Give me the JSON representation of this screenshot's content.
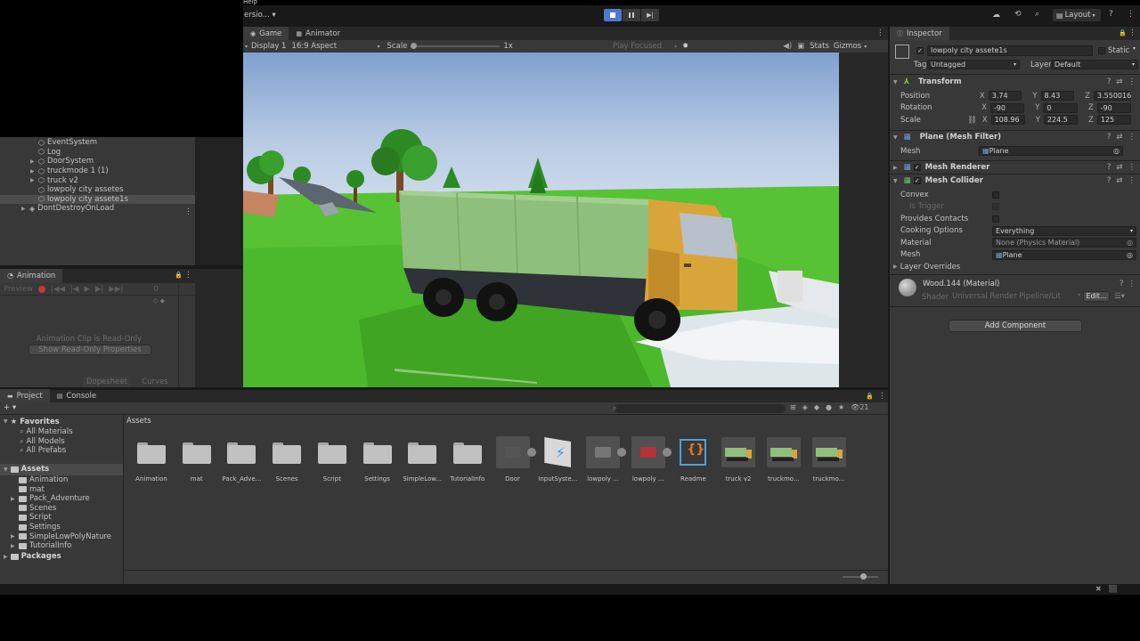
{
  "menu": {
    "help": "Help",
    "version": "ersio...",
    "layout": "Layout"
  },
  "game_view": {
    "tabs": [
      {
        "label": "Game"
      },
      {
        "label": "Animator"
      }
    ],
    "display": "Display 1",
    "aspect": "16:9 Aspect",
    "scale_label": "Scale",
    "scale_value": "1x",
    "play_focused": "Play Focused",
    "stats": "Stats",
    "gizmos": "Gizmos"
  },
  "hierarchy": {
    "items": [
      {
        "label": "EventSystem",
        "indent": 2,
        "arrow": false
      },
      {
        "label": "Log",
        "indent": 2,
        "arrow": false
      },
      {
        "label": "DoorSystem",
        "indent": 2,
        "arrow": true
      },
      {
        "label": "truckmode 1 (1)",
        "indent": 2,
        "arrow": true
      },
      {
        "label": "truck v2",
        "indent": 2,
        "arrow": true
      },
      {
        "label": "lowpoly city assetes",
        "indent": 2,
        "arrow": false
      },
      {
        "label": "lowpoly city assete1s",
        "indent": 2,
        "arrow": false,
        "selected": true
      },
      {
        "label": "DontDestroyOnLoad",
        "indent": 1,
        "arrow": true
      }
    ]
  },
  "animation": {
    "title": "Animation",
    "preview": "Preview",
    "frame": "0",
    "read_only": "Animation Clip is Read-Only",
    "show_props": "Show Read-Only Properties",
    "dopesheet": "Dopesheet",
    "curves": "Curves"
  },
  "project": {
    "tabs": [
      {
        "label": "Project"
      },
      {
        "label": "Console"
      }
    ],
    "count": "21",
    "breadcrumb": "Assets",
    "favorites_label": "Favorites",
    "favorites": [
      "All Materials",
      "All Models",
      "All Prefabs"
    ],
    "assets_label": "Assets",
    "folders": [
      "Animation",
      "mat",
      "Pack_Adventure",
      "Scenes",
      "Script",
      "Settings",
      "SimpleLowPolyNature",
      "TutorialInfo"
    ],
    "packages_label": "Packages",
    "grid": [
      {
        "label": "Animation",
        "kind": "folder"
      },
      {
        "label": "mat",
        "kind": "folder"
      },
      {
        "label": "Pack_Adve...",
        "kind": "folder"
      },
      {
        "label": "Scenes",
        "kind": "folder"
      },
      {
        "label": "Script",
        "kind": "folder"
      },
      {
        "label": "Settings",
        "kind": "folder"
      },
      {
        "label": "SimpleLow...",
        "kind": "folder"
      },
      {
        "label": "TutorialInfo",
        "kind": "folder"
      },
      {
        "label": "Door",
        "kind": "prefab"
      },
      {
        "label": "InputSyste...",
        "kind": "input"
      },
      {
        "label": "lowpoly ...",
        "kind": "prefab"
      },
      {
        "label": "lowpoly ...",
        "kind": "prefab"
      },
      {
        "label": "Readme",
        "kind": "readme"
      },
      {
        "label": "truck v2",
        "kind": "truck"
      },
      {
        "label": "truckmo...",
        "kind": "truck"
      },
      {
        "label": "truckmo...",
        "kind": "truck"
      }
    ]
  },
  "inspector": {
    "title": "Inspector",
    "object_name": "lowpoly city assete1s",
    "static": "Static",
    "tag_label": "Tag",
    "tag": "Untagged",
    "layer_label": "Layer",
    "layer": "Default",
    "transform": {
      "title": "Transform",
      "position_label": "Position",
      "position": {
        "x": "3.74",
        "y": "8.43",
        "z": "3.550016"
      },
      "rotation_label": "Rotation",
      "rotation": {
        "x": "-90",
        "y": "0",
        "z": "-90"
      },
      "scale_label": "Scale",
      "scale": {
        "x": "108.96",
        "y": "224.5",
        "z": "125"
      }
    },
    "mesh_filter": {
      "title": "Plane (Mesh Filter)",
      "mesh_label": "Mesh",
      "mesh": "Plane"
    },
    "mesh_renderer": {
      "title": "Mesh Renderer"
    },
    "mesh_collider": {
      "title": "Mesh Collider",
      "convex": "Convex",
      "is_trigger": "Is Trigger",
      "provides_contacts": "Provides Contacts",
      "cooking_label": "Cooking Options",
      "cooking": "Everything",
      "material_label": "Material",
      "material": "None (Physics Material)",
      "mesh_label": "Mesh",
      "mesh": "Plane"
    },
    "layer_overrides": "Layer Overrides",
    "material": {
      "name": "Wood.144 (Material)",
      "shader_label": "Shader",
      "shader": "Universal Render Pipeline/Lit",
      "edit": "Edit..."
    },
    "add_component": "Add Component"
  },
  "colors": {
    "accent": "#4d78cc",
    "panel": "#383838",
    "dark": "#282828",
    "sky": "#b9cbe6",
    "grass": "#5bc43a",
    "truck_cab": "#d9a53a",
    "truck_bed": "#8fc07a"
  }
}
